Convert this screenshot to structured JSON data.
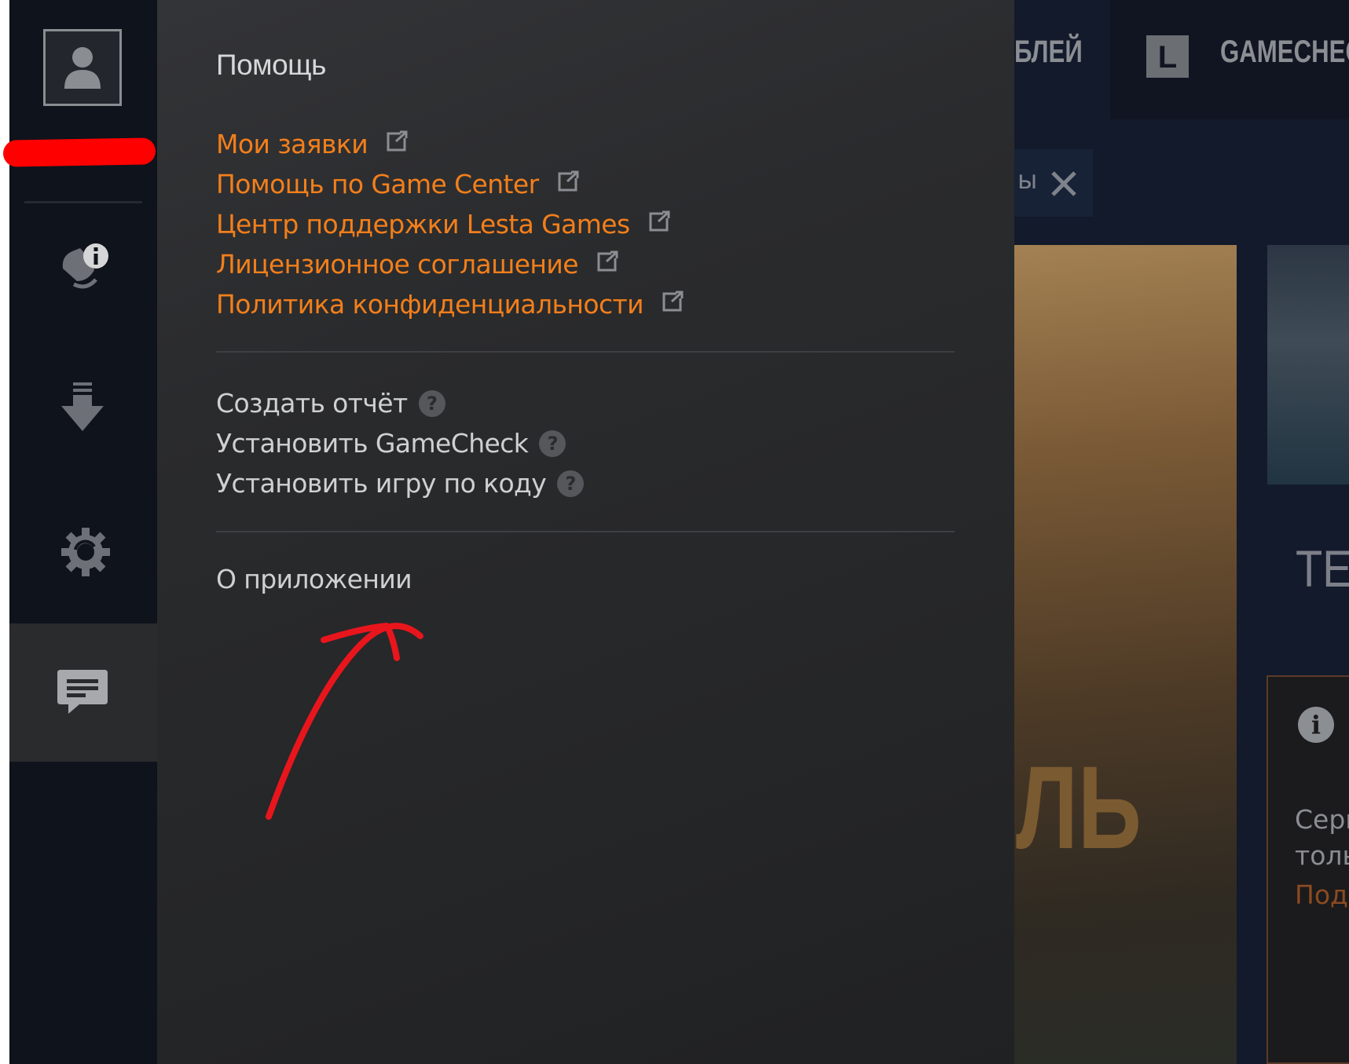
{
  "sidebar": {
    "icons": [
      "user-icon",
      "notification-info-icon",
      "download-icon",
      "settings-gear-icon",
      "chat-message-icon"
    ]
  },
  "help_panel": {
    "title": "Помощь",
    "links": [
      {
        "label": "Мои заявки",
        "icon": "external-link-icon"
      },
      {
        "label": "Помощь по Game Center",
        "icon": "external-link-icon"
      },
      {
        "label": "Центр поддержки Lesta Games",
        "icon": "external-link-icon"
      },
      {
        "label": "Лицензионное соглашение",
        "icon": "external-link-icon"
      },
      {
        "label": "Политика конфиденциальности",
        "icon": "external-link-icon"
      }
    ],
    "actions": [
      {
        "label": "Создать отчёт",
        "help": "?"
      },
      {
        "label": "Установить GameCheck",
        "help": "?"
      },
      {
        "label": "Установить игру по коду",
        "help": "?"
      }
    ],
    "about_label": "О приложении",
    "link_color": "#f27f1b"
  },
  "background_app": {
    "nav_fragment_1": "БЛЕЙ",
    "nav_l_icon": "L",
    "nav_fragment_2": "GAMECHEC",
    "subbar_fragment": "ы",
    "banner_fragment": "ЛЬ",
    "heading_fragment": "TE",
    "info_lines": [
      "Серв",
      "толь",
      "Под"
    ]
  },
  "annotations": {
    "redaction_color": "#ff0000",
    "arrow_color": "#e8161c"
  }
}
